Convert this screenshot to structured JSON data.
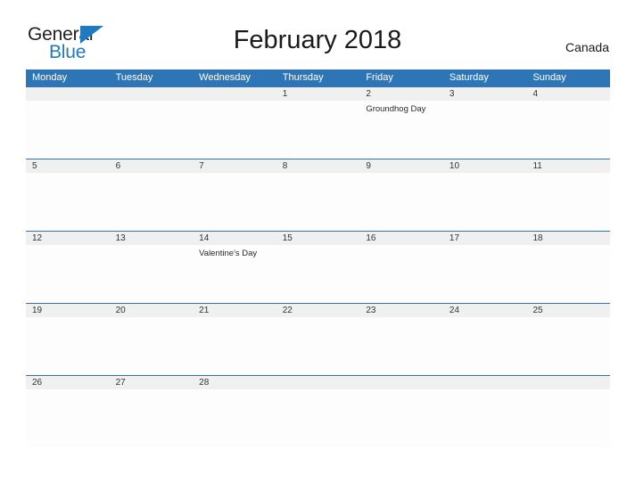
{
  "brand": {
    "word_general": "General",
    "word_blue": "Blue",
    "flag_color": "#1f7bc1",
    "general_color": "#231f20",
    "blue_color": "#1f7bc1"
  },
  "header": {
    "title": "February 2018",
    "region": "Canada",
    "accent_color": "#2e75b6",
    "band_color": "#f0f0f0"
  },
  "weekdays": [
    "Monday",
    "Tuesday",
    "Wednesday",
    "Thursday",
    "Friday",
    "Saturday",
    "Sunday"
  ],
  "weeks": [
    {
      "days": [
        {
          "num": "",
          "event": ""
        },
        {
          "num": "",
          "event": ""
        },
        {
          "num": "",
          "event": ""
        },
        {
          "num": "1",
          "event": ""
        },
        {
          "num": "2",
          "event": "Groundhog Day"
        },
        {
          "num": "3",
          "event": ""
        },
        {
          "num": "4",
          "event": ""
        }
      ]
    },
    {
      "days": [
        {
          "num": "5",
          "event": ""
        },
        {
          "num": "6",
          "event": ""
        },
        {
          "num": "7",
          "event": ""
        },
        {
          "num": "8",
          "event": ""
        },
        {
          "num": "9",
          "event": ""
        },
        {
          "num": "10",
          "event": ""
        },
        {
          "num": "11",
          "event": ""
        }
      ]
    },
    {
      "days": [
        {
          "num": "12",
          "event": ""
        },
        {
          "num": "13",
          "event": ""
        },
        {
          "num": "14",
          "event": "Valentine's Day"
        },
        {
          "num": "15",
          "event": ""
        },
        {
          "num": "16",
          "event": ""
        },
        {
          "num": "17",
          "event": ""
        },
        {
          "num": "18",
          "event": ""
        }
      ]
    },
    {
      "days": [
        {
          "num": "19",
          "event": ""
        },
        {
          "num": "20",
          "event": ""
        },
        {
          "num": "21",
          "event": ""
        },
        {
          "num": "22",
          "event": ""
        },
        {
          "num": "23",
          "event": ""
        },
        {
          "num": "24",
          "event": ""
        },
        {
          "num": "25",
          "event": ""
        }
      ]
    },
    {
      "days": [
        {
          "num": "26",
          "event": ""
        },
        {
          "num": "27",
          "event": ""
        },
        {
          "num": "28",
          "event": ""
        },
        {
          "num": "",
          "event": ""
        },
        {
          "num": "",
          "event": ""
        },
        {
          "num": "",
          "event": ""
        },
        {
          "num": "",
          "event": ""
        }
      ]
    }
  ]
}
